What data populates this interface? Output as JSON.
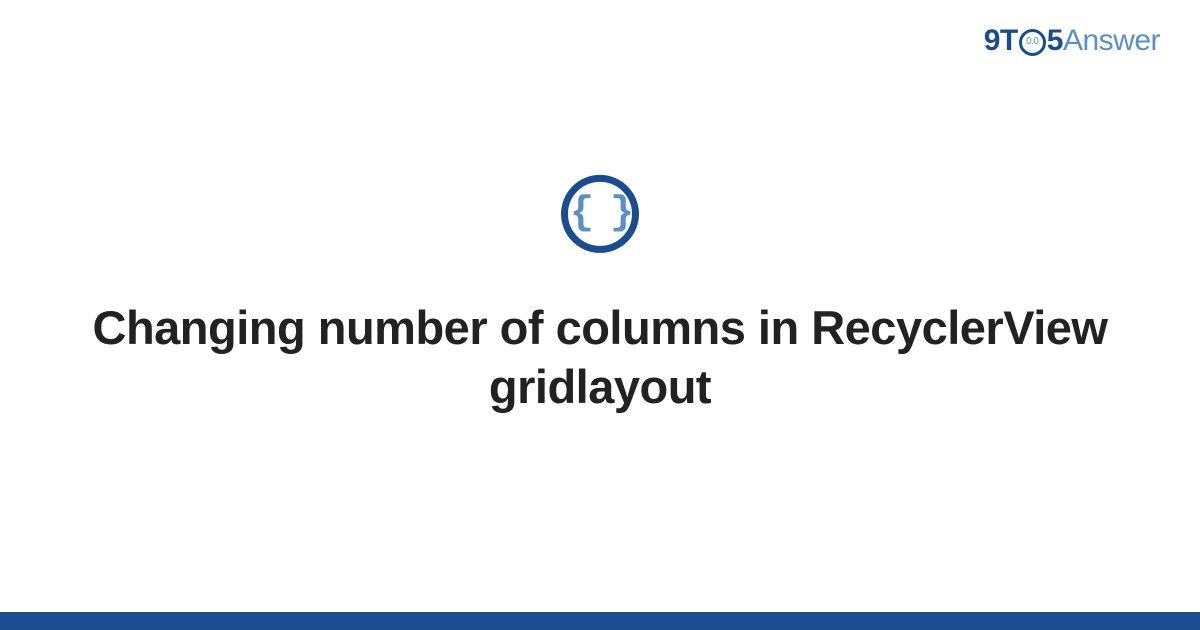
{
  "logo": {
    "part1": "9T",
    "ring_inner": "0.0",
    "part2": "5",
    "part3": "Answer"
  },
  "icon": {
    "name": "code-braces-icon",
    "glyph": "{ }"
  },
  "title": "Changing number of columns in RecyclerView gridlayout",
  "colors": {
    "primary": "#1a4d8f",
    "accent": "#5a8fc7",
    "text": "#222222",
    "background": "#ffffff"
  }
}
